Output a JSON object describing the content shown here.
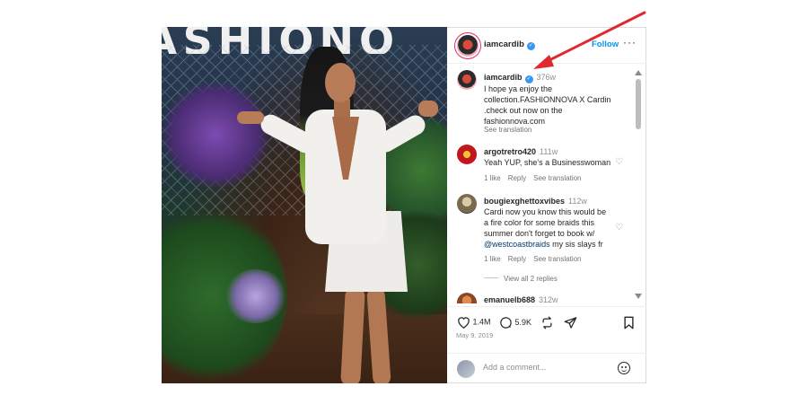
{
  "post": {
    "username": "iamcardib",
    "follow_label": "Follow",
    "more_label": "···",
    "caption": {
      "username": "iamcardib",
      "time": "376w",
      "lines": [
        "I hope ya enjoy the",
        "collection.FASHIONNOVA X Cardin",
        ".check out now on the",
        "fashionnova.com"
      ],
      "see_translation": "See translation"
    },
    "comments": [
      {
        "username": "argotretro420",
        "time": "111w",
        "lines": [
          "Yeah YUP, she's a Businesswoman"
        ],
        "likes": "1 like",
        "reply": "Reply",
        "see_translation": "See translation"
      },
      {
        "username": "bougiexghettoxvibes",
        "time": "112w",
        "lines": [
          "Cardi now you know this would be",
          "a fire color for some braids this",
          "summer don't forget to book w/"
        ],
        "mention": "@westcoastbraids",
        "after_mention": " my sis slays fr",
        "likes": "1 like",
        "reply": "Reply",
        "see_translation": "See translation",
        "view_replies": "View all 2 replies"
      },
      {
        "username": "emanuelb688",
        "time": "312w"
      }
    ],
    "likes_count": "1.4M",
    "comments_count": "5.9K",
    "date": "May 9, 2019",
    "add_comment_placeholder": "Add a comment...",
    "photo_sign_text": "ASHIONO"
  },
  "colors": {
    "accent": "#0095f6",
    "annotation_arrow": "#e0282e"
  }
}
